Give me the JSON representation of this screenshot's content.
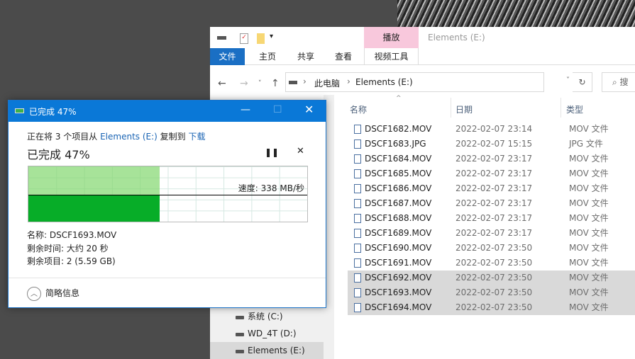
{
  "explorer": {
    "title": "Elements (E:)",
    "context_tab": "播放",
    "ribbon_tabs": [
      "文件",
      "主页",
      "共享",
      "查看",
      "视频工具"
    ],
    "breadcrumb": [
      "此电脑",
      "Elements (E:)"
    ],
    "search_placeholder": "搜",
    "columns": [
      "名称",
      "日期",
      "类型"
    ],
    "files": [
      {
        "name": "DSCF1682.MOV",
        "date": "2022-02-07 23:14",
        "type": "MOV 文件",
        "selected": false
      },
      {
        "name": "DSCF1683.JPG",
        "date": "2022-02-07 15:15",
        "type": "JPG 文件",
        "selected": false
      },
      {
        "name": "DSCF1684.MOV",
        "date": "2022-02-07 23:17",
        "type": "MOV 文件",
        "selected": false
      },
      {
        "name": "DSCF1685.MOV",
        "date": "2022-02-07 23:17",
        "type": "MOV 文件",
        "selected": false
      },
      {
        "name": "DSCF1686.MOV",
        "date": "2022-02-07 23:17",
        "type": "MOV 文件",
        "selected": false
      },
      {
        "name": "DSCF1687.MOV",
        "date": "2022-02-07 23:17",
        "type": "MOV 文件",
        "selected": false
      },
      {
        "name": "DSCF1688.MOV",
        "date": "2022-02-07 23:17",
        "type": "MOV 文件",
        "selected": false
      },
      {
        "name": "DSCF1689.MOV",
        "date": "2022-02-07 23:17",
        "type": "MOV 文件",
        "selected": false
      },
      {
        "name": "DSCF1690.MOV",
        "date": "2022-02-07 23:50",
        "type": "MOV 文件",
        "selected": false
      },
      {
        "name": "DSCF1691.MOV",
        "date": "2022-02-07 23:50",
        "type": "MOV 文件",
        "selected": false
      },
      {
        "name": "DSCF1692.MOV",
        "date": "2022-02-07 23:50",
        "type": "MOV 文件",
        "selected": true
      },
      {
        "name": "DSCF1693.MOV",
        "date": "2022-02-07 23:50",
        "type": "MOV 文件",
        "selected": true
      },
      {
        "name": "DSCF1694.MOV",
        "date": "2022-02-07 23:50",
        "type": "MOV 文件",
        "selected": true
      }
    ],
    "drives": [
      {
        "label": "系统 (C:)",
        "selected": false
      },
      {
        "label": "WD_4T (D:)",
        "selected": false
      },
      {
        "label": "Elements (E:)",
        "selected": true
      }
    ]
  },
  "dialog": {
    "title": "已完成 47%",
    "line_prefix": "正在将 3 个项目从",
    "source": "Elements (E:)",
    "line_mid": "复制到",
    "dest": "下载",
    "percent_text": "已完成 47%",
    "progress": 0.47,
    "speed": "速度: 338 MB/秒",
    "name": "名称: DSCF1693.MOV",
    "time_left": "剩余时间: 大约 20 秒",
    "items_left": "剩余项目: 2 (5.59 GB)",
    "less_details": "简略信息"
  }
}
